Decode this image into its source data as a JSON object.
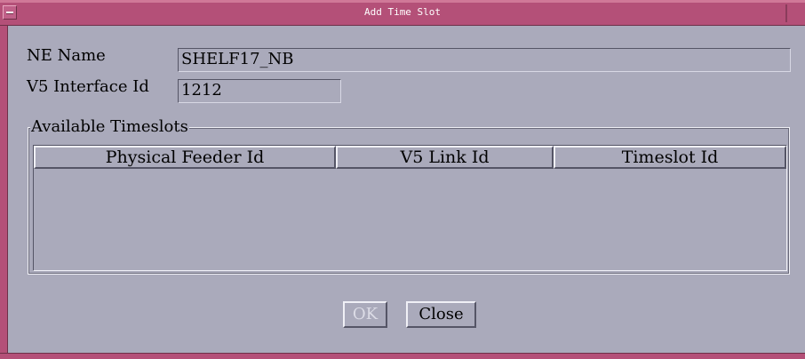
{
  "window": {
    "title": "Add Time Slot"
  },
  "form": {
    "ne_name_label": "NE Name",
    "ne_name_value": "SHELF17_NB",
    "v5_interface_label": "V5 Interface Id",
    "v5_interface_value": "1212"
  },
  "timeslots": {
    "group_title": "Available Timeslots",
    "columns": [
      "Physical Feeder Id",
      "V5 Link Id",
      "Timeslot Id"
    ],
    "rows": []
  },
  "buttons": {
    "ok_label": "OK",
    "ok_enabled": false,
    "close_label": "Close"
  },
  "colors": {
    "titlebar": "#b45078",
    "background": "#aaaabb"
  }
}
